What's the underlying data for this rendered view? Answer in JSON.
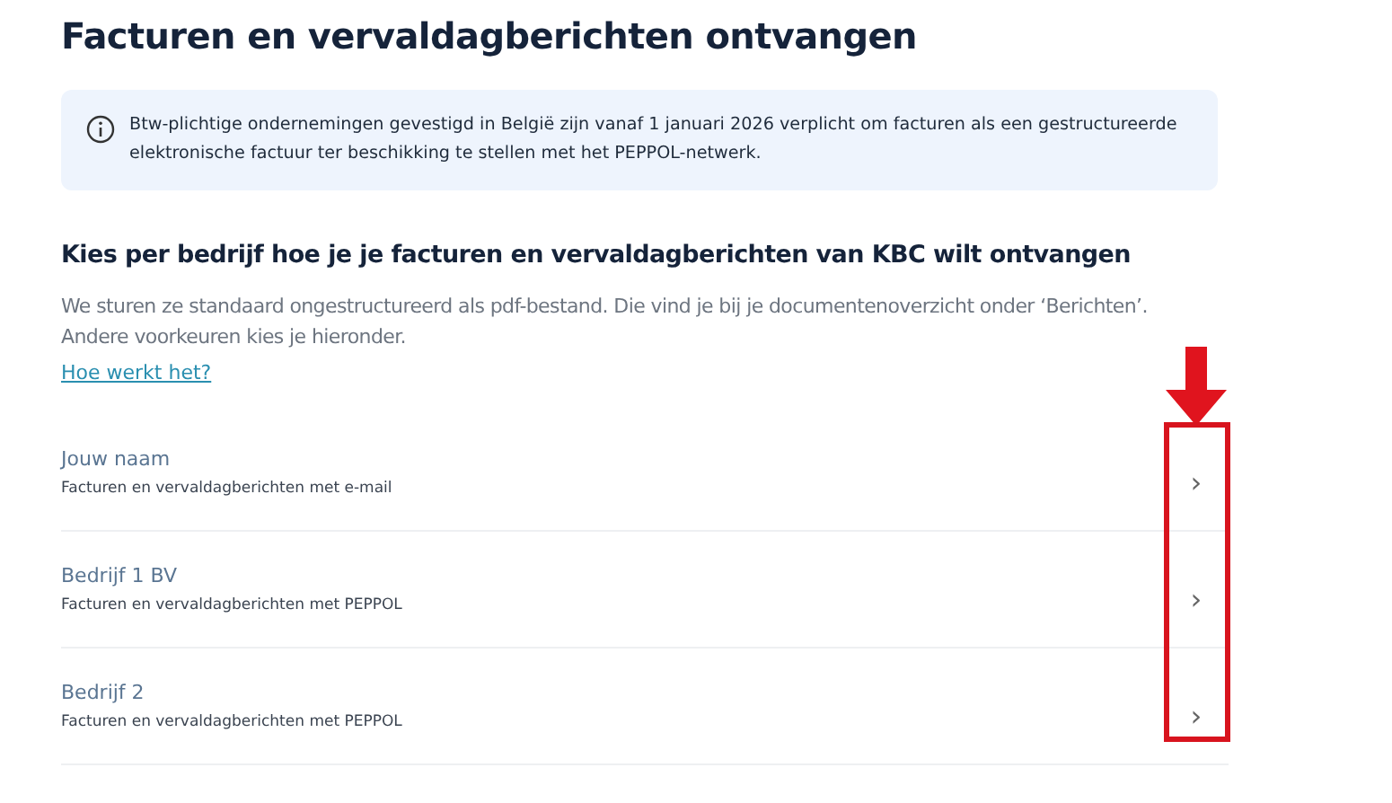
{
  "title": "Facturen en vervaldagberichten ontvangen",
  "info": {
    "text": "Btw-plichtige ondernemingen gevestigd in België zijn vanaf 1 januari 2026 verplicht om facturen als een gestructureerde elektronische factuur ter beschikking te stellen met het PEPPOL-netwerk."
  },
  "section": {
    "heading": "Kies per bedrijf hoe je je facturen en vervaldagberichten van KBC wilt ontvangen",
    "lines": [
      "We sturen ze standaard ongestructureerd als pdf-bestand. Die vind je bij je documentenoverzicht onder ‘Berichten’.",
      "Andere voorkeuren kies je hieronder."
    ],
    "link": "Hoe werkt het?"
  },
  "companies": [
    {
      "name": "Jouw naam",
      "detail": "Facturen en vervaldagberichten met e-mail",
      "chevron": "›"
    },
    {
      "name": "Bedrijf 1 BV",
      "detail": "Facturen en vervaldagberichten met PEPPOL",
      "chevron": "›"
    },
    {
      "name": "Bedrijf 2",
      "detail": "Facturen en vervaldagberichten met PEPPOL",
      "chevron": "›"
    }
  ]
}
